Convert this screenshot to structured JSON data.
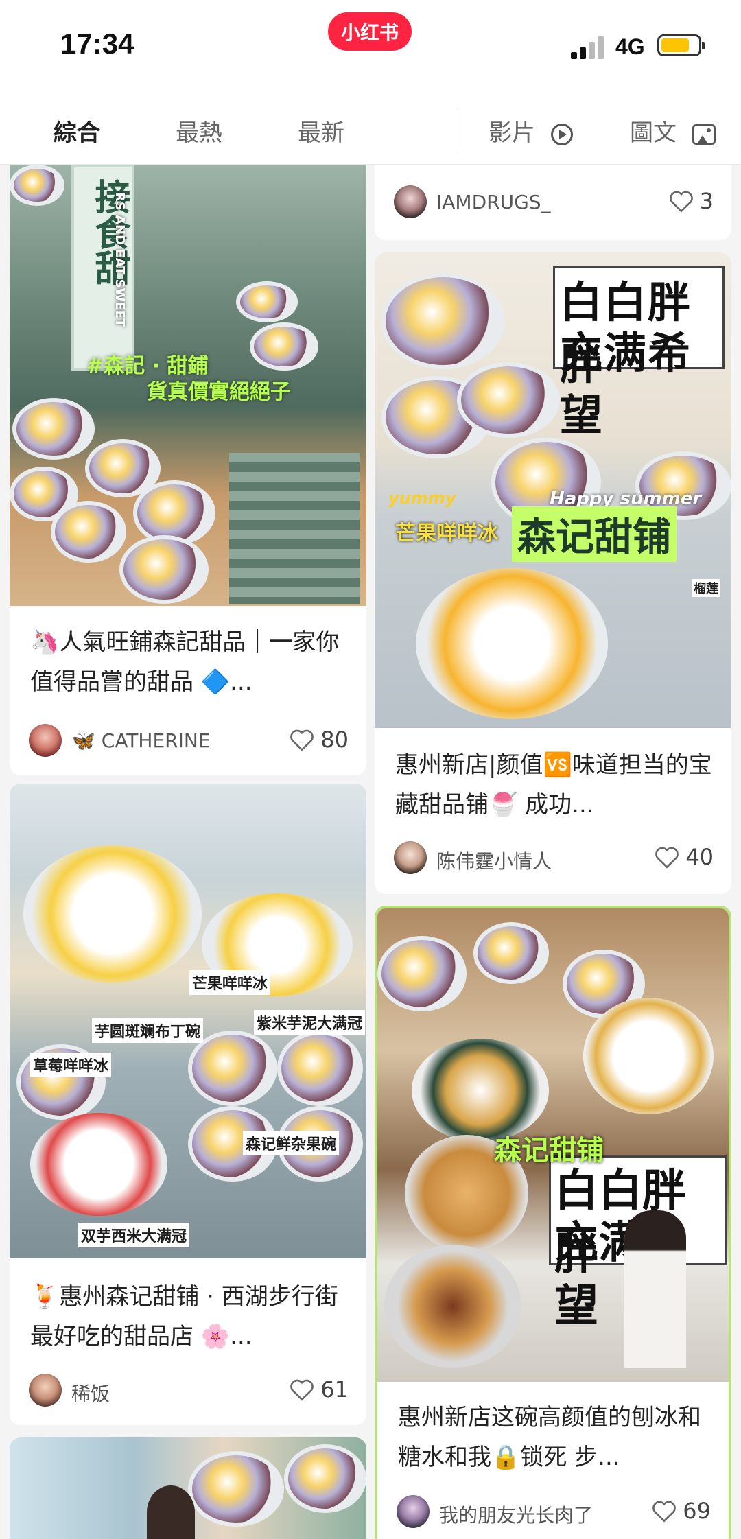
{
  "status_bar": {
    "time": "17:34",
    "network": "4G",
    "battery_level": 0.76
  },
  "app_logo": "小红书",
  "tabs": {
    "all": "綜合",
    "hot": "最熱",
    "latest": "最新",
    "video": "影片",
    "image_text": "圖文"
  },
  "cards": [
    {
      "title": "🦄人氣旺鋪森記甜品｜一家你值得品嘗的甜品 🔷...",
      "author": "🦋 CATHERINE",
      "likes": "80",
      "overlay": [
        "#森記 · 甜鋪",
        "貨真價實絕絕子",
        "接食甜",
        "RS AND EAT SWEET"
      ]
    },
    {
      "title": "🍹惠州森记甜铺 · 西湖步行街最好吃的甜品店 🌸...",
      "author": "稀饭",
      "likes": "61",
      "overlay": [
        "芒果咩咩冰",
        "紫米芋泥大满冠",
        "芋圆斑斓布丁碗",
        "草莓咩咩冰",
        "森记鲜杂果碗",
        "双芋西米大满冠"
      ]
    },
    {
      "author": "IAMDRUGS_",
      "likes": "3"
    },
    {
      "title": "惠州新店|颜值🆚味道担当的宝藏甜品铺🍧 成功...",
      "author": "陈伟霆小情人",
      "likes": "40",
      "overlay": [
        "白白胖胖",
        "充满希望",
        "yummy",
        "Happy summer",
        "芒果咩咩冰",
        "森记甜铺",
        "榴莲"
      ]
    },
    {
      "title": "惠州新店这碗高颜值的刨冰和糖水和我🔒锁死 步...",
      "author": "我的朋友光长肉了",
      "likes": "69",
      "overlay": [
        "森记甜铺",
        "白白胖胖",
        "充满希望"
      ]
    }
  ],
  "colors": {
    "brand": "#ff2442",
    "highlight_border": "#b9e07a",
    "neon": "#b6ff4a"
  }
}
